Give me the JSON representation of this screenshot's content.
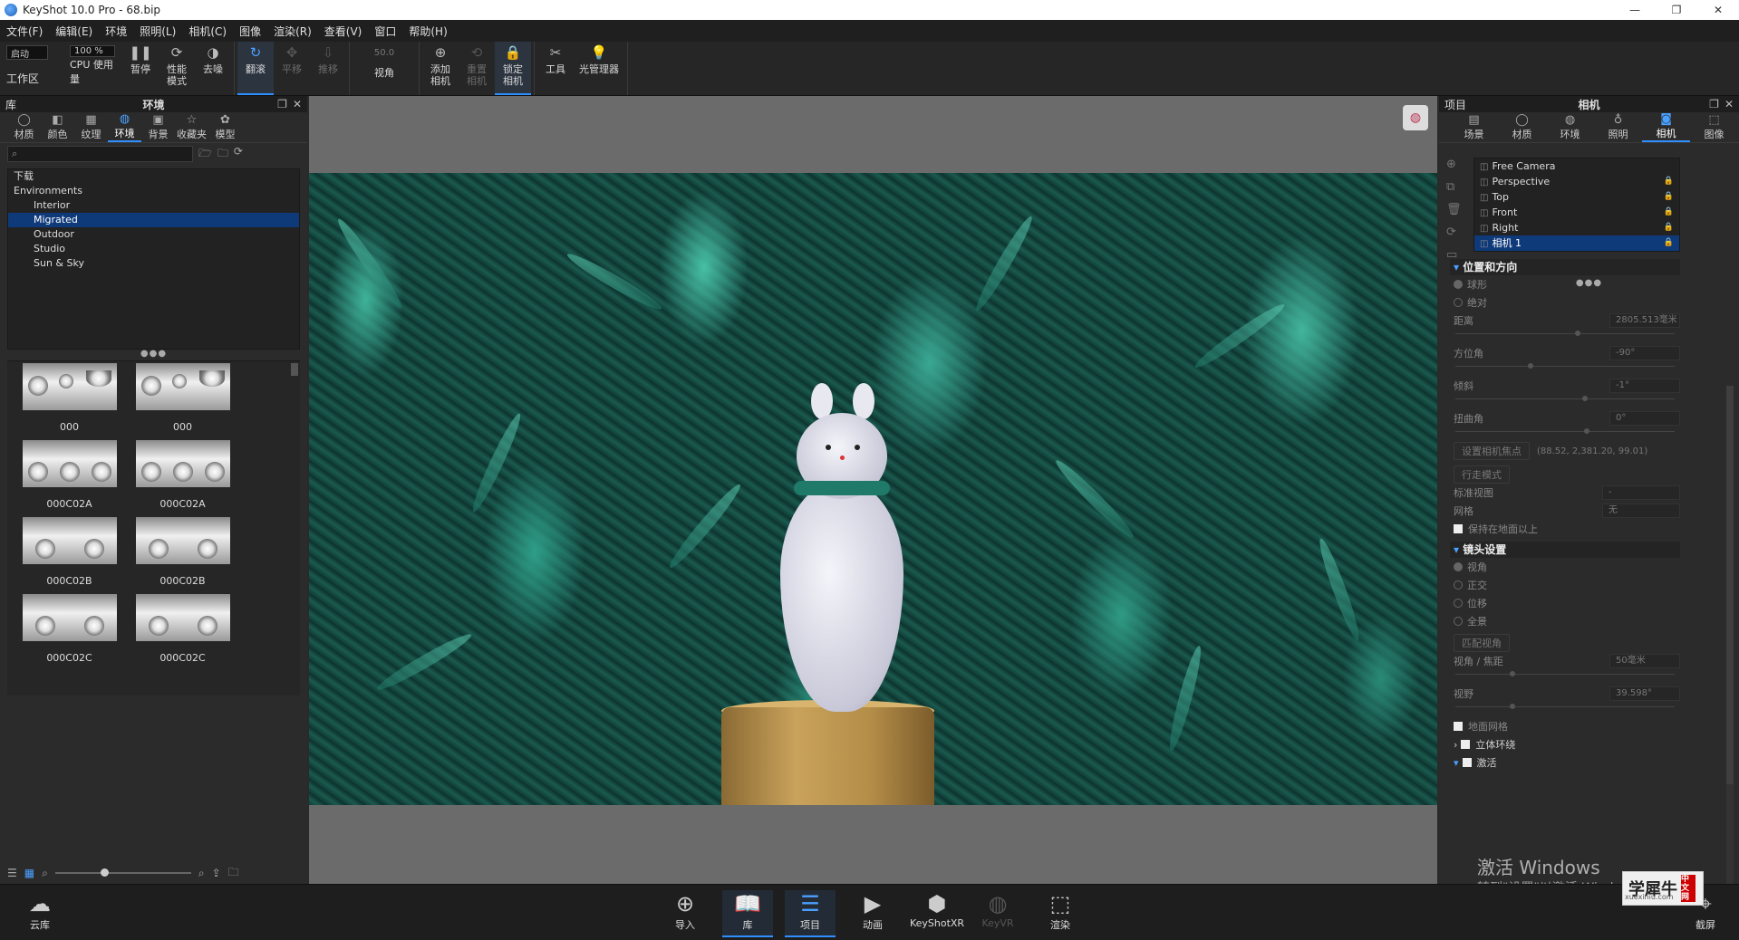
{
  "window": {
    "title": "KeyShot 10.0 Pro  - 68.bip",
    "controls": [
      "—",
      "❐",
      "✕"
    ]
  },
  "menu": [
    "文件(F)",
    "编辑(E)",
    "环境",
    "照明(L)",
    "相机(C)",
    "图像",
    "渲染(R)",
    "查看(V)",
    "窗口",
    "帮助(H)"
  ],
  "toolbar": {
    "startup_value": "启动",
    "cpu_percent": "100 %",
    "workspace_label": "工作区",
    "cpu_label": "CPU 使用量",
    "pause_label": "暂停",
    "perf_label": "性能\n模式",
    "denoise_label": "去噪",
    "tumble_label": "翻滚",
    "pan_label": "平移",
    "dolly_label": "推移",
    "fov_value": "50.0",
    "fov_label": "视角",
    "add_camera_label": "添加\n相机",
    "reset_camera_label": "重置\n相机",
    "lock_camera_label": "锁定\n相机",
    "tools_label": "工具",
    "light_manager_label": "光管理器"
  },
  "library": {
    "panel_title_left": "库",
    "panel_title": "环境",
    "tabs": [
      "材质",
      "颜色",
      "纹理",
      "环境",
      "背景",
      "收藏夹",
      "模型"
    ],
    "active_tab": "环境",
    "search_placeholder": "",
    "tree": {
      "root0": "下载",
      "root1": "Environments",
      "items": [
        "Interior",
        "Migrated",
        "Outdoor",
        "Studio",
        "Sun & Sky"
      ],
      "selected": "Migrated"
    },
    "thumbnails": [
      "000",
      "000",
      "000C02A",
      "000C02A",
      "000C02B",
      "000C02B",
      "000C02C",
      "000C02C"
    ]
  },
  "project": {
    "panel_title_left": "项目",
    "panel_title": "相机",
    "tabs": [
      "场景",
      "材质",
      "环境",
      "照明",
      "相机",
      "图像"
    ],
    "active_tab": "相机",
    "cameras": [
      "Free Camera",
      "Perspective",
      "Top",
      "Front",
      "Right",
      "相机 1"
    ],
    "selected_camera": "相机 1",
    "section_position": "位置和方向",
    "opt_spherical": "球形",
    "opt_absolute": "绝对",
    "distance_label": "距离",
    "distance_value": "2805.513毫米",
    "azimuth_label": "方位角",
    "azimuth_value": "-90°",
    "incline_label": "倾斜",
    "incline_value": "-1°",
    "twist_label": "扭曲角",
    "twist_value": "0°",
    "set_focus_label": "设置相机焦点",
    "focus_coords": "(88.52, 2,381.20, 99.01)",
    "walk_mode_label": "行走模式",
    "standard_view_label": "标准视图",
    "standard_view_value": "-",
    "grid_label": "网格",
    "grid_value": "无",
    "keep_above_ground_label": "保持在地面以上",
    "section_lens": "镜头设置",
    "lens_perspective": "视角",
    "lens_ortho": "正交",
    "lens_shift": "位移",
    "lens_panorama": "全景",
    "match_perspective_label": "匹配视角",
    "fov_focal_label": "视角 / 焦距",
    "fov_focal_value": "50毫米",
    "field_of_view_label": "视野",
    "field_of_view_value": "39.598°",
    "ground_grid_label": "地面网格",
    "stereo_label": "立体环绕",
    "activate_label": "激活"
  },
  "watermark": {
    "line1": "激活 Windows",
    "line2": "转到\"设置\"以激活 Windows。"
  },
  "brand": {
    "name": "学犀牛",
    "tag": "中文网",
    "url": "xuexiniu.com"
  },
  "bottombar": {
    "cloud_label": "云库",
    "import_label": "导入",
    "library_label": "库",
    "project_label": "项目",
    "animation_label": "动画",
    "keyshotxr_label": "KeyShotXR",
    "keyvr_label": "KeyVR",
    "render_label": "渲染",
    "screenshot_label": "截屏"
  }
}
